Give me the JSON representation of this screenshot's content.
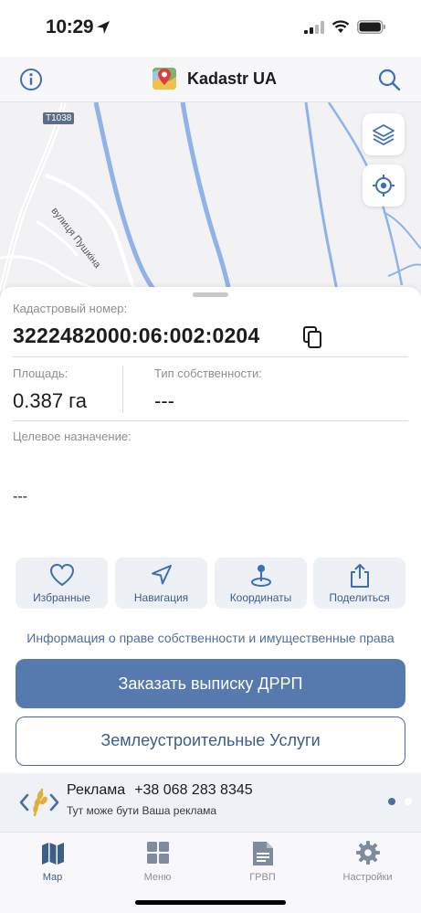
{
  "status": {
    "time": "10:29"
  },
  "header": {
    "title": "Kadastr UA"
  },
  "map": {
    "route_label": "T1038",
    "street_label": "вулиця Пушкіна"
  },
  "parcel": {
    "cadastral_label": "Кадастровый номер:",
    "cadastral_number": "3222482000:06:002:0204",
    "area_label": "Площадь:",
    "area_value": "0.387 га",
    "ownership_label": "Тип собственности:",
    "ownership_value": "---",
    "purpose_label": "Целевое назначение:",
    "purpose_value": "---"
  },
  "actions": [
    {
      "label": "Избранные",
      "icon": "heart-icon"
    },
    {
      "label": "Навигация",
      "icon": "navigation-arrow-icon"
    },
    {
      "label": "Координаты",
      "icon": "pin-icon"
    },
    {
      "label": "Поделиться",
      "icon": "share-icon"
    }
  ],
  "rights_link": "Информация о праве собственности и имущественные права",
  "buttons": {
    "order_extract": "Заказать выписку ДРРП",
    "land_services": "Землеустроительные Услуги"
  },
  "ad": {
    "title": "Реклама",
    "phone": "+38 068 283 8345",
    "subtitle": "Тут може бути Ваша реклама"
  },
  "tabs": [
    {
      "label": "Мар",
      "icon": "map-icon",
      "active": true
    },
    {
      "label": "Меню",
      "icon": "grid-icon",
      "active": false
    },
    {
      "label": "ГРВП",
      "icon": "document-icon",
      "active": false
    },
    {
      "label": "Настройки",
      "icon": "gear-icon",
      "active": false
    }
  ],
  "colors": {
    "accent": "#567aae",
    "accent_text": "#3d5d8a",
    "action_bg": "#edf1f6",
    "river": "#8fb3e8"
  }
}
